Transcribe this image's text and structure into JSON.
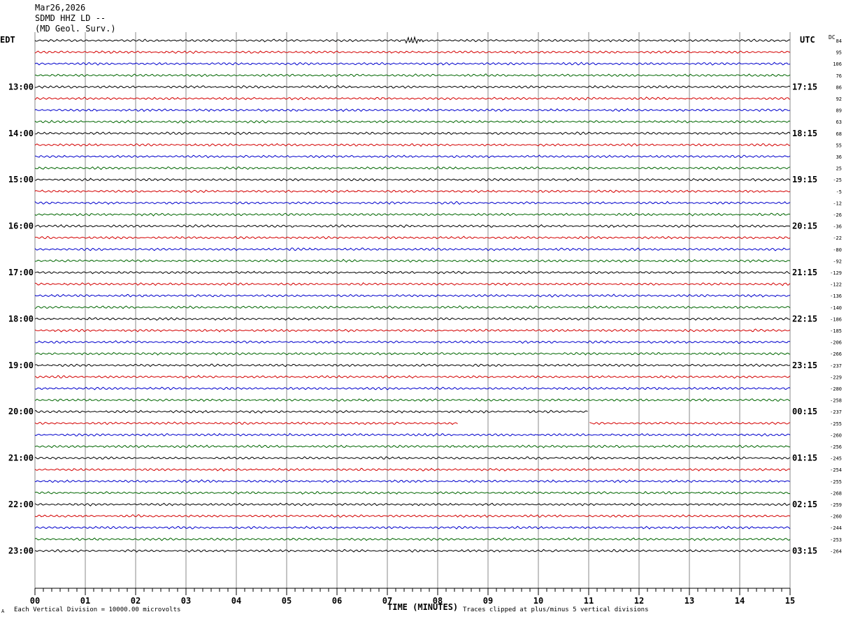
{
  "header": {
    "date": "Mar26,2026",
    "station": "SDMD HHZ LD --",
    "network": "(MD Geol. Surv.)"
  },
  "timezones": {
    "left": "EDT",
    "right": "UTC",
    "dc": "DC"
  },
  "footer": {
    "scale_note": "Each Vertical Division = 10000.00 microvolts",
    "clip_note": "Traces clipped at plus/minus 5 vertical divisions",
    "corner_mark": "A"
  },
  "chart_data": {
    "type": "line",
    "title": "",
    "xlabel": "TIME (MINUTES)",
    "x_ticks": [
      "00",
      "01",
      "02",
      "03",
      "04",
      "05",
      "06",
      "07",
      "08",
      "09",
      "10",
      "11",
      "12",
      "13",
      "14",
      "15"
    ],
    "xlim": [
      0,
      15
    ],
    "grid": true,
    "trace_colors": [
      "#000000",
      "#d40000",
      "#0000cc",
      "#006600"
    ],
    "left_hour_labels": [
      "13:00",
      "14:00",
      "15:00",
      "16:00",
      "17:00",
      "18:00",
      "19:00",
      "20:00",
      "21:00",
      "22:00",
      "23:00"
    ],
    "right_hour_labels": [
      "17:15",
      "18:15",
      "19:15",
      "20:15",
      "21:15",
      "22:15",
      "23:15",
      "00:15",
      "01:15",
      "02:15",
      "03:15"
    ],
    "dc_offsets": [
      "84",
      "95",
      "106",
      "76",
      "86",
      "92",
      "89",
      "63",
      "68",
      "55",
      "36",
      "25",
      "-25",
      "-5",
      "-12",
      "-26",
      "-36",
      "-22",
      "-80",
      "-92",
      "-129",
      "-122",
      "-136",
      "-140",
      "-186",
      "-185",
      "-206",
      "-266",
      "-237",
      "-229",
      "-280",
      "-258",
      "-237",
      "-255",
      "-260",
      "-256",
      "-245",
      "-254",
      "-255",
      "-268",
      "-259",
      "-260",
      "-244",
      "-253",
      "-264"
    ],
    "gaps": [
      {
        "trace": 32,
        "from_min": 11.0,
        "to_min": 15.0
      },
      {
        "trace": 33,
        "from_min": 8.4,
        "to_min": 10.0
      },
      {
        "trace": 33,
        "from_min": 10.0,
        "to_min": 11.0
      }
    ],
    "events": [
      {
        "trace": 0,
        "minute": 7.5,
        "label": ""
      }
    ]
  }
}
